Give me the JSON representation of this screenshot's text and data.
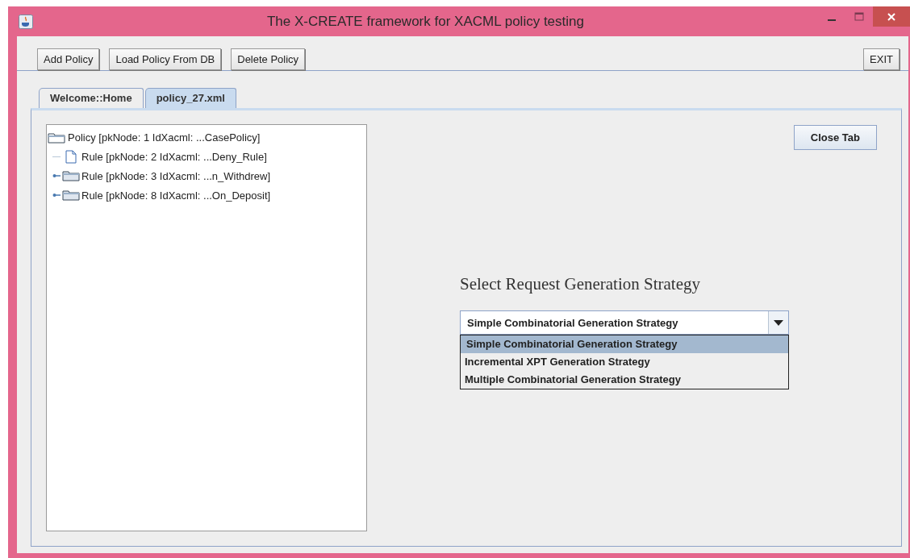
{
  "window": {
    "title": "The X-CREATE framework for XACML policy testing"
  },
  "toolbar": {
    "buttons": [
      "Add Policy",
      "Load Policy From DB",
      "Delete Policy"
    ],
    "exit": "EXIT"
  },
  "tabs": [
    {
      "label": "Welcome::Home",
      "selected": false
    },
    {
      "label": "policy_27.xml",
      "selected": true
    }
  ],
  "tree": [
    {
      "label": "Policy [pkNode: 1 IdXacml: ...CasePolicy]",
      "kind": "folder",
      "expanded": true,
      "children": [
        {
          "label": "Rule [pkNode: 2 IdXacml: ...Deny_Rule]",
          "kind": "leaf"
        },
        {
          "label": "Rule [pkNode: 3 IdXacml: ...n_Withdrew]",
          "kind": "folder",
          "expanded": false
        },
        {
          "label": "Rule [pkNode: 8 IdXacml: ...On_Deposit]",
          "kind": "folder",
          "expanded": false
        }
      ]
    }
  ],
  "close_tab": "Close Tab",
  "strategy": {
    "heading": "Select Request Generation Strategy",
    "value": "Simple Combinatorial Generation Strategy",
    "options": [
      {
        "label": "Simple Combinatorial Generation Strategy",
        "selected": true
      },
      {
        "label": "Incremental XPT Generation Strategy",
        "selected": false
      },
      {
        "label": "Multiple Combinatorial Generation Strategy",
        "selected": false
      }
    ]
  }
}
